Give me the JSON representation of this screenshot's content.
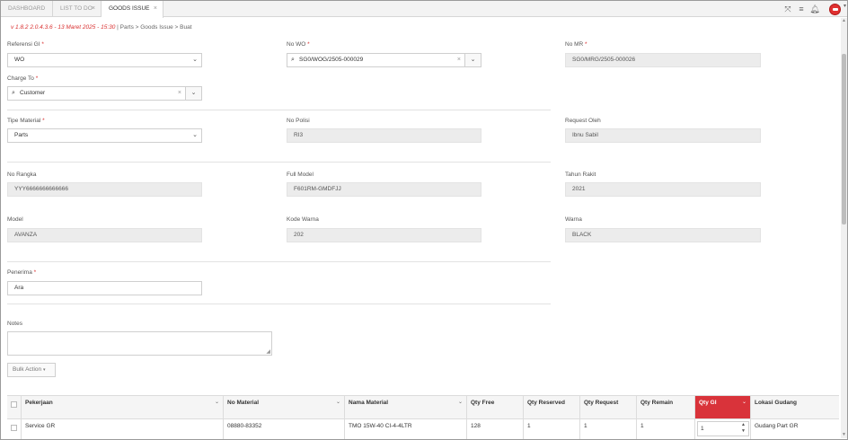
{
  "tabs": [
    {
      "label": "DASHBOARD",
      "closable": false
    },
    {
      "label": "LIST TO DO",
      "closable": true
    },
    {
      "label": "GOODS ISSUE",
      "closable": true
    }
  ],
  "breadcrumb": {
    "version": "v 1.8.2 2.0.4.3.6 - 13 Maret 2025 - 15:30",
    "path": "| Parts > Goods Issue > Buat"
  },
  "form": {
    "referensi_gi": {
      "label": "Referensi GI",
      "value": "WO"
    },
    "no_wo": {
      "label": "No WO",
      "value": "SG0/WOG/2505-000029"
    },
    "no_mr": {
      "label": "No MR",
      "value": "SG0/MRG/2505-000026"
    },
    "charge_to": {
      "label": "Charge To",
      "value": "Customer"
    },
    "tipe_material": {
      "label": "Tipe Material",
      "value": "Parts"
    },
    "no_polisi": {
      "label": "No Polisi",
      "value": "RI3"
    },
    "request_oleh": {
      "label": "Request Oleh",
      "value": "Ibnu Sabil"
    },
    "no_rangka": {
      "label": "No Rangka",
      "value": "YYY6666666666666"
    },
    "full_model": {
      "label": "Full Model",
      "value": "F601RM-GMDFJJ"
    },
    "tahun_rakit": {
      "label": "Tahun Rakit",
      "value": "2021"
    },
    "model": {
      "label": "Model",
      "value": "AVANZA"
    },
    "kode_warna": {
      "label": "Kode Warna",
      "value": "202"
    },
    "warna": {
      "label": "Warna",
      "value": "BLACK"
    },
    "penerima": {
      "label": "Penerima",
      "value": "Ara"
    },
    "notes": {
      "label": "Notes",
      "value": ""
    }
  },
  "bulk_action": "Bulk Action",
  "table": {
    "headers": [
      "Pekerjaan",
      "No Material",
      "Nama Material",
      "Qty Free",
      "Qty Reserved",
      "Qty Request",
      "Qty Remain",
      "Qty GI",
      "Lokasi Gudang"
    ],
    "rows": [
      [
        "Service GR",
        "08880-83352",
        "TMO 15W-40 CI-4-4LTR",
        "128",
        "1",
        "1",
        "1",
        "1",
        "Gudang Part GR"
      ]
    ]
  },
  "colors": {
    "accent": "#d9333a",
    "version_text": "#d93030"
  },
  "icons": [
    "fullscreen-icon",
    "menu-icon",
    "bell-icon",
    "user-avatar-icon",
    "search-icon",
    "chevron-down-icon",
    "close-icon"
  ]
}
